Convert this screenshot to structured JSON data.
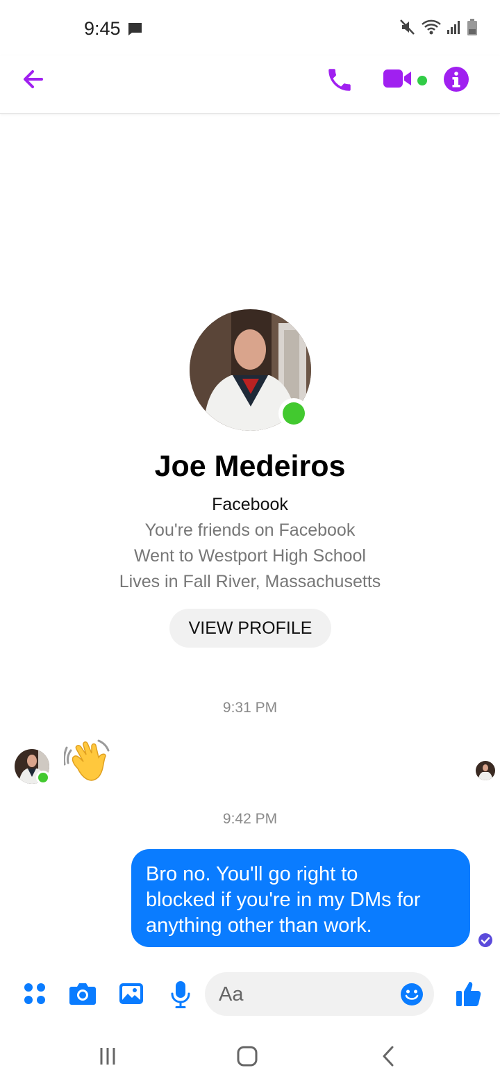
{
  "status_bar": {
    "time": "9:45",
    "icons": [
      "message-icon",
      "mute-icon",
      "wifi-icon",
      "signal-icon",
      "battery-icon"
    ]
  },
  "header": {
    "icons": [
      "back-arrow-icon",
      "phone-call-icon",
      "video-call-icon",
      "info-icon"
    ],
    "accent_color": "#a020f0",
    "online_color": "#31cc46"
  },
  "profile": {
    "name": "Joe Medeiros",
    "source": "Facebook",
    "details": [
      "You're friends on Facebook",
      "Went to Westport High School",
      "Lives in Fall River, Massachusetts"
    ],
    "view_profile_label": "VIEW PROFILE",
    "online": true
  },
  "conversation": {
    "timestamps": [
      "9:31 PM",
      "9:42 PM"
    ],
    "received": {
      "emoji": "waving-hand-icon"
    },
    "sent": {
      "lines": [
        "Bro no. You'll go right to",
        "blocked if you're in my DMs for",
        "anything other than work."
      ],
      "status": "seen-check-icon",
      "bubble_color": "#0a7cff"
    }
  },
  "composer": {
    "placeholder": "Aa",
    "icons": [
      "apps-grid-icon",
      "camera-icon",
      "gallery-icon",
      "microphone-icon",
      "emoji-icon",
      "thumbs-up-icon"
    ],
    "icon_color": "#0a7cff"
  },
  "nav_bar": {
    "icons": [
      "recents-icon",
      "home-icon",
      "back-icon"
    ]
  }
}
